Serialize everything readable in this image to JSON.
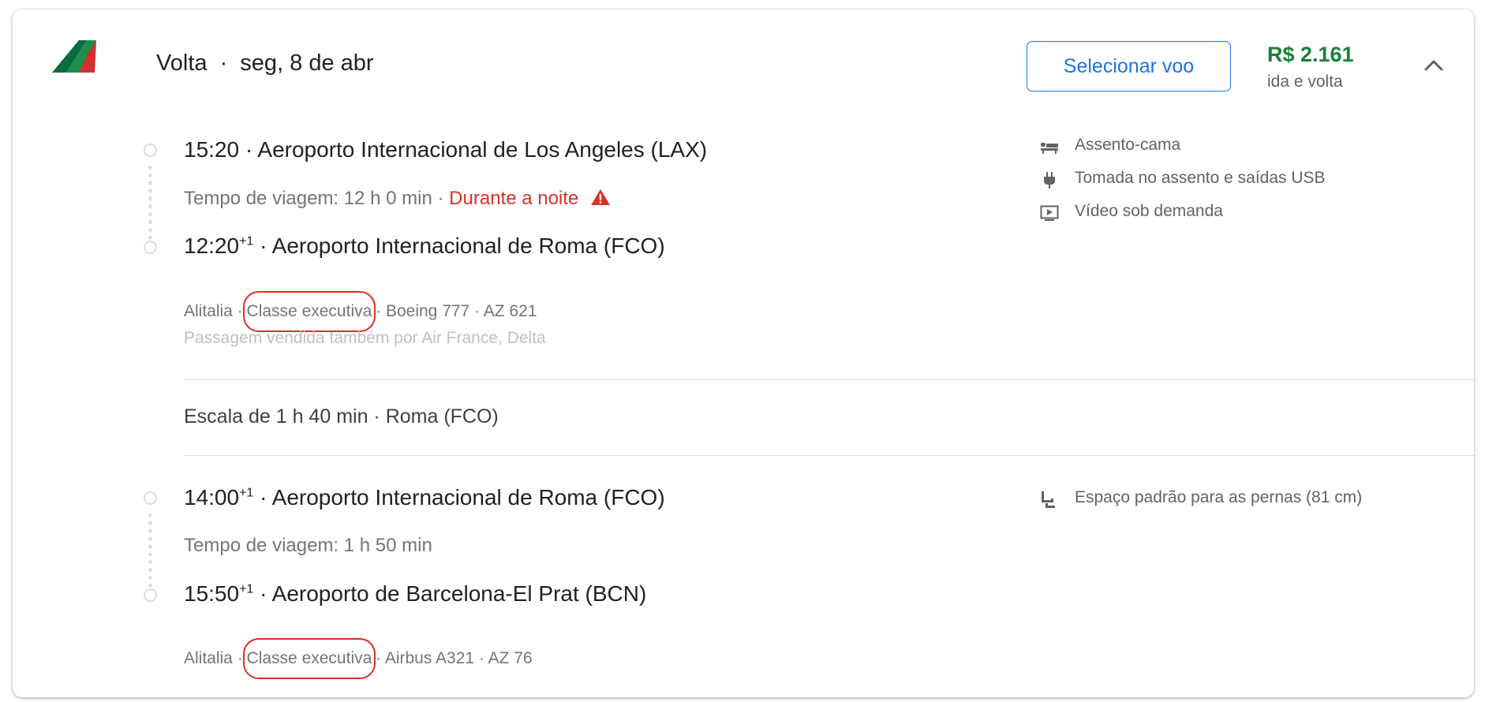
{
  "header": {
    "direction": "Volta",
    "separator": "·",
    "date": "seg, 8 de abr",
    "select_label": "Selecionar voo",
    "price": "R$ 2.161",
    "price_note": "ida e volta"
  },
  "colors": {
    "accent": "#1a73e8",
    "price": "#188038",
    "warning": "#d93025",
    "airline_green": "#0b6b3a",
    "airline_red": "#d32f2f"
  },
  "segments": [
    {
      "departure_time": "15:20",
      "departure_airport": " · Aeroporto Internacional de Los Angeles (LAX)",
      "travel_time": "Tempo de viagem: 12 h 0 min · ",
      "overnight": "Durante a noite",
      "arrival_time": "12:20",
      "arrival_day_offset": "+1",
      "arrival_airport": " · Aeroporto Internacional de Roma (FCO)",
      "airline": "Alitalia",
      "cabin": "Classe executiva",
      "aircraft": "Boeing 777",
      "flight_number": "AZ 621",
      "sold_by": "Passagem vendida também por Air France, Delta",
      "amenities": [
        {
          "icon": "lie-flat-seat-icon",
          "label": "Assento-cama"
        },
        {
          "icon": "power-outlet-icon",
          "label": "Tomada no assento e saídas USB"
        },
        {
          "icon": "video-on-demand-icon",
          "label": "Vídeo sob demanda"
        }
      ]
    },
    {
      "departure_time": "14:00",
      "departure_day_offset": "+1",
      "departure_airport": " · Aeroporto Internacional de Roma (FCO)",
      "travel_time": "Tempo de viagem: 1 h 50 min",
      "arrival_time": "15:50",
      "arrival_day_offset": "+1",
      "arrival_airport": " · Aeroporto de Barcelona-El Prat (BCN)",
      "airline": "Alitalia",
      "cabin": "Classe executiva",
      "aircraft": "Airbus A321",
      "flight_number": "AZ 76",
      "amenities": [
        {
          "icon": "legroom-icon",
          "label": "Espaço padrão para as pernas (81 cm)"
        }
      ]
    }
  ],
  "layover": "Escala de 1 h 40 min · Roma (FCO)",
  "meta_separator": " · "
}
